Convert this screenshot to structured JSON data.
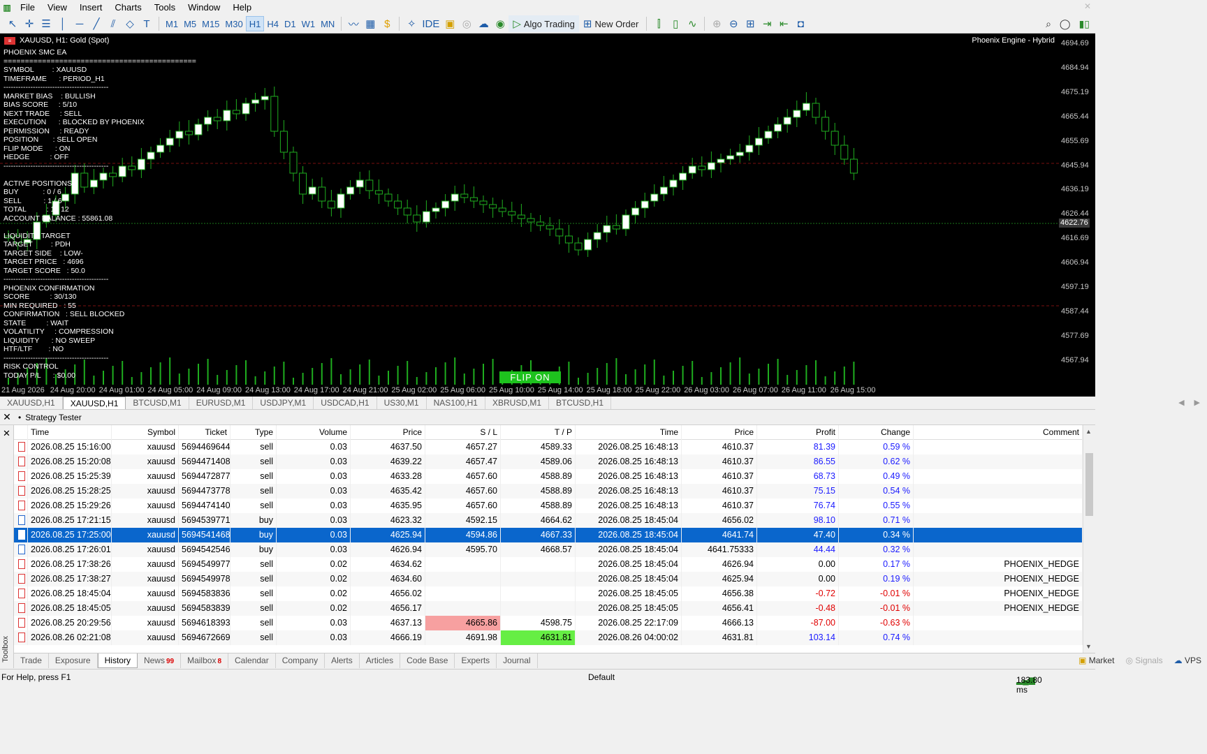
{
  "menu": {
    "items": [
      "File",
      "View",
      "Insert",
      "Charts",
      "Tools",
      "Window",
      "Help"
    ]
  },
  "toolbar": {
    "timeframes": [
      "M1",
      "M5",
      "M15",
      "M30",
      "H1",
      "H4",
      "D1",
      "W1",
      "MN"
    ],
    "active_tf": "H1",
    "ide": "IDE",
    "algo_trading": "Algo Trading",
    "new_order": "New Order"
  },
  "chart": {
    "title": "XAUUSD, H1:  Gold (Spot)",
    "engine": "Phoenix Engine - Hybrid",
    "flip": "FLIP ON",
    "current_price": "4622.76",
    "price_labels": [
      "4694.69",
      "4684.94",
      "4675.19",
      "4665.44",
      "4655.69",
      "4645.94",
      "4636.19",
      "4626.44",
      "4616.69",
      "4606.94",
      "4597.19",
      "4587.44",
      "4577.69",
      "4567.94"
    ],
    "time_labels": [
      "21 Aug 2026",
      "24 Aug 20:00",
      "24 Aug 01:00",
      "24 Aug 05:00",
      "24 Aug 09:00",
      "24 Aug 13:00",
      "24 Aug 17:00",
      "24 Aug 21:00",
      "25 Aug 02:00",
      "25 Aug 06:00",
      "25 Aug 10:00",
      "25 Aug 14:00",
      "25 Aug 18:00",
      "25 Aug 22:00",
      "26 Aug 03:00",
      "26 Aug 07:00",
      "26 Aug 11:00",
      "26 Aug 15:00"
    ],
    "panel": [
      "PHOENIX SMC EA",
      "=============================================",
      "SYMBOL         : XAUUSD",
      "TIMEFRAME      : PERIOD_H1",
      "-------------------------------------------",
      "MARKET BIAS    : BULLISH",
      "BIAS SCORE     : 5/10",
      "NEXT TRADE     : SELL",
      "EXECUTION      : BLOCKED BY PHOENIX",
      "PERMISSION     : READY",
      "POSITION       : SELL OPEN",
      "FLIP MODE      : ON",
      "HEDGE          : OFF",
      "-------------------------------------------",
      "",
      "ACTIVE POSITIONS",
      "BUY            : 0 / 6",
      "SELL           : 1 / 6",
      "TOTAL          : 1 / 12",
      "ACCOUNT BALANCE : 55861.08",
      "",
      "LIQUIDITY TARGET",
      "TARGET         : PDH",
      "TARGET SIDE    : LOW-",
      "TARGET PRICE   : 4696",
      "TARGET SCORE   : 50.0",
      "-------------------------------------------",
      "PHOENIX CONFIRMATION",
      "SCORE          : 30/130",
      "MIN REQUIRED   : 55",
      "CONFIRMATION   : SELL BLOCKED",
      "STATE          : WAIT",
      "VOLATILITY     : COMPRESSION",
      "LIQUIDITY      : NO SWEEP",
      "HTF/LTF        : NO",
      "-------------------------------------------",
      "RISK CONTROL",
      "TODAY P/L      : $0.00"
    ]
  },
  "chart_tabs": [
    "XAUUSD,H1",
    "XAUUSD,H1",
    "BTCUSD,M1",
    "EURUSD,M1",
    "USDJPY,M1",
    "USDCAD,H1",
    "US30,M1",
    "NAS100,H1",
    "XBRUSD,M1",
    "BTCUSD,H1"
  ],
  "toolbox": {
    "title": "Strategy Tester",
    "side_label": "Toolbox",
    "columns": [
      "Time",
      "Symbol",
      "Ticket",
      "Type",
      "Volume",
      "Price",
      "S / L",
      "T / P",
      "Time",
      "Price",
      "Profit",
      "Change",
      "Comment"
    ],
    "rows": [
      {
        "time": "2026.08.25 15:16:00",
        "symbol": "xauusd",
        "ticket": "5694469644",
        "type": "sell",
        "volume": "0.03",
        "price": "4637.50",
        "sl": "4657.27",
        "tp": "4589.33",
        "ctime": "2026.08.25 16:48:13",
        "cprice": "4610.37",
        "profit": "81.39",
        "change": "0.59 %",
        "comment": ""
      },
      {
        "time": "2026.08.25 15:20:08",
        "symbol": "xauusd",
        "ticket": "5694471408",
        "type": "sell",
        "volume": "0.03",
        "price": "4639.22",
        "sl": "4657.47",
        "tp": "4589.06",
        "ctime": "2026.08.25 16:48:13",
        "cprice": "4610.37",
        "profit": "86.55",
        "change": "0.62 %",
        "comment": ""
      },
      {
        "time": "2026.08.25 15:25:39",
        "symbol": "xauusd",
        "ticket": "5694472877",
        "type": "sell",
        "volume": "0.03",
        "price": "4633.28",
        "sl": "4657.60",
        "tp": "4588.89",
        "ctime": "2026.08.25 16:48:13",
        "cprice": "4610.37",
        "profit": "68.73",
        "change": "0.49 %",
        "comment": ""
      },
      {
        "time": "2026.08.25 15:28:25",
        "symbol": "xauusd",
        "ticket": "5694473778",
        "type": "sell",
        "volume": "0.03",
        "price": "4635.42",
        "sl": "4657.60",
        "tp": "4588.89",
        "ctime": "2026.08.25 16:48:13",
        "cprice": "4610.37",
        "profit": "75.15",
        "change": "0.54 %",
        "comment": ""
      },
      {
        "time": "2026.08.25 15:29:26",
        "symbol": "xauusd",
        "ticket": "5694474140",
        "type": "sell",
        "volume": "0.03",
        "price": "4635.95",
        "sl": "4657.60",
        "tp": "4588.89",
        "ctime": "2026.08.25 16:48:13",
        "cprice": "4610.37",
        "profit": "76.74",
        "change": "0.55 %",
        "comment": ""
      },
      {
        "time": "2026.08.25 17:21:15",
        "symbol": "xauusd",
        "ticket": "5694539771",
        "type": "buy",
        "volume": "0.03",
        "price": "4623.32",
        "sl": "4592.15",
        "tp": "4664.62",
        "ctime": "2026.08.25 18:45:04",
        "cprice": "4656.02",
        "profit": "98.10",
        "change": "0.71 %",
        "comment": ""
      },
      {
        "time": "2026.08.25 17:25:00",
        "symbol": "xauusd",
        "ticket": "5694541468",
        "type": "buy",
        "volume": "0.03",
        "price": "4625.94",
        "sl": "4594.86",
        "tp": "4667.33",
        "ctime": "2026.08.25 18:45:04",
        "cprice": "4641.74",
        "profit": "47.40",
        "change": "0.34 %",
        "comment": "",
        "selected": true
      },
      {
        "time": "2026.08.25 17:26:01",
        "symbol": "xauusd",
        "ticket": "5694542546",
        "type": "buy",
        "volume": "0.03",
        "price": "4626.94",
        "sl": "4595.70",
        "tp": "4668.57",
        "ctime": "2026.08.25 18:45:04",
        "cprice": "4641.75333",
        "profit": "44.44",
        "change": "0.32 %",
        "comment": ""
      },
      {
        "time": "2026.08.25 17:38:26",
        "symbol": "xauusd",
        "ticket": "5694549977",
        "type": "sell",
        "volume": "0.02",
        "price": "4634.62",
        "sl": "",
        "tp": "",
        "ctime": "2026.08.25 18:45:04",
        "cprice": "4626.94",
        "profit": "0.00",
        "change": "0.17 %",
        "comment": "PHOENIX_HEDGE"
      },
      {
        "time": "2026.08.25 17:38:27",
        "symbol": "xauusd",
        "ticket": "5694549978",
        "type": "sell",
        "volume": "0.02",
        "price": "4634.60",
        "sl": "",
        "tp": "",
        "ctime": "2026.08.25 18:45:04",
        "cprice": "4625.94",
        "profit": "0.00",
        "change": "0.19 %",
        "comment": "PHOENIX_HEDGE"
      },
      {
        "time": "2026.08.25 18:45:04",
        "symbol": "xauusd",
        "ticket": "5694583836",
        "type": "sell",
        "volume": "0.02",
        "price": "4656.02",
        "sl": "",
        "tp": "",
        "ctime": "2026.08.25 18:45:05",
        "cprice": "4656.38",
        "profit": "-0.72",
        "change": "-0.01 %",
        "comment": "PHOENIX_HEDGE"
      },
      {
        "time": "2026.08.25 18:45:05",
        "symbol": "xauusd",
        "ticket": "5694583839",
        "type": "sell",
        "volume": "0.02",
        "price": "4656.17",
        "sl": "",
        "tp": "",
        "ctime": "2026.08.25 18:45:05",
        "cprice": "4656.41",
        "profit": "-0.48",
        "change": "-0.01 %",
        "comment": "PHOENIX_HEDGE"
      },
      {
        "time": "2026.08.25 20:29:56",
        "symbol": "xauusd",
        "ticket": "5694618393",
        "type": "sell",
        "volume": "0.03",
        "price": "4637.13",
        "sl": "4665.86",
        "tp": "4598.75",
        "ctime": "2026.08.25 22:17:09",
        "cprice": "4666.13",
        "profit": "-87.00",
        "change": "-0.63 %",
        "comment": "",
        "sl_hit": true
      },
      {
        "time": "2026.08.26 02:21:08",
        "symbol": "xauusd",
        "ticket": "5694672669",
        "type": "sell",
        "volume": "0.03",
        "price": "4666.19",
        "sl": "4691.98",
        "tp": "4631.81",
        "ctime": "2026.08.26 04:00:02",
        "cprice": "4631.81",
        "profit": "103.14",
        "change": "0.74 %",
        "comment": "",
        "tp_hit": true
      }
    ]
  },
  "bottom_tabs": [
    {
      "label": "Trade"
    },
    {
      "label": "Exposure"
    },
    {
      "label": "History",
      "active": true
    },
    {
      "label": "News",
      "badge": "99"
    },
    {
      "label": "Mailbox",
      "badge": "8"
    },
    {
      "label": "Calendar"
    },
    {
      "label": "Company"
    },
    {
      "label": "Alerts"
    },
    {
      "label": "Articles"
    },
    {
      "label": "Code Base"
    },
    {
      "label": "Experts"
    },
    {
      "label": "Journal"
    }
  ],
  "bottom_right": {
    "market": "Market",
    "signals": "Signals",
    "vps": "VPS"
  },
  "status": {
    "help": "For Help, press F1",
    "profile": "Default",
    "ping": "183.80 ms"
  }
}
